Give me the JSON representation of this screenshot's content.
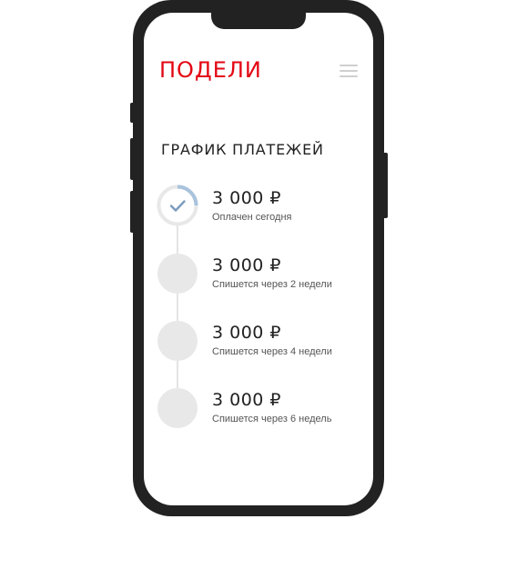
{
  "brand": {
    "logo_text": "ПОДЕЛИ",
    "color": "#e30613"
  },
  "header": {
    "menu_icon": "hamburger-menu-icon"
  },
  "schedule": {
    "title": "ГРАФИК ПЛАТЕЖЕЙ",
    "payments": [
      {
        "amount": "3 000 ₽",
        "caption": "Оплачен сегодня",
        "status": "paid",
        "progress": 0.25
      },
      {
        "amount": "3 000 ₽",
        "caption": "Спишется через 2 недели",
        "status": "pending"
      },
      {
        "amount": "3 000 ₽",
        "caption": "Спишется через 4 недели",
        "status": "pending"
      },
      {
        "amount": "3 000 ₽",
        "caption": "Спишется через 6 недель",
        "status": "pending"
      }
    ]
  },
  "colors": {
    "frame": "#222222",
    "accent_progress": "#a9c3dc",
    "check": "#7a9bbd",
    "pending_circle": "#e8e8e8"
  }
}
